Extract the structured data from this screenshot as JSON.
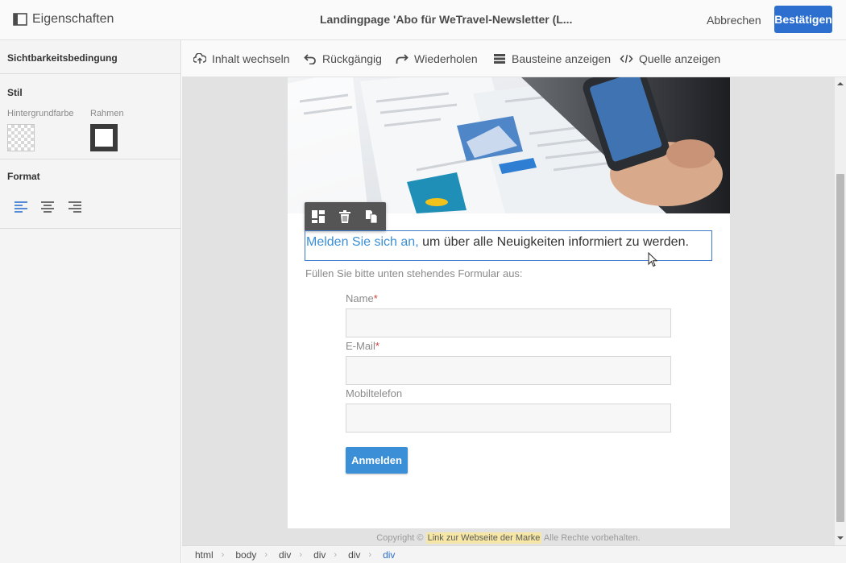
{
  "header": {
    "panel_title": "Eigenschaften",
    "doc_title": "Landingpage 'Abo für WeTravel-Newsletter (L...",
    "cancel_label": "Abbrechen",
    "confirm_label": "Bestätigen"
  },
  "left_panel": {
    "visibility_label": "Sichtbarkeitsbedingung",
    "style": {
      "title": "Stil",
      "background_label": "Hintergrundfarbe",
      "border_label": "Rahmen"
    },
    "format": {
      "title": "Format",
      "alignments": [
        "left",
        "center",
        "right"
      ],
      "active_alignment": "left"
    }
  },
  "toolbar": {
    "items": [
      {
        "label": "Inhalt wechseln",
        "icon": "cloud-upload-icon"
      },
      {
        "label": "Rückgängig",
        "icon": "undo-icon"
      },
      {
        "label": "Wiederholen",
        "icon": "redo-icon"
      },
      {
        "label": "Bausteine anzeigen",
        "icon": "list-icon"
      },
      {
        "label": "Quelle anzeigen",
        "icon": "code-icon"
      }
    ]
  },
  "block_toolbar": {
    "icons": [
      "layout-icon",
      "trash-icon",
      "duplicate-icon"
    ]
  },
  "content": {
    "headline_link": "Melden Sie sich an,",
    "headline_rest": " um über alle Neuigkeiten informiert zu werden.",
    "subtext": "Füllen Sie bitte unten stehendes Formular aus:",
    "fields": [
      {
        "label": "Name",
        "required": true,
        "value": ""
      },
      {
        "label": "E-Mail",
        "required": true,
        "value": ""
      },
      {
        "label": "Mobiltelefon",
        "required": false,
        "value": ""
      }
    ],
    "required_marker": "*",
    "submit_label": "Anmelden"
  },
  "footer": {
    "copyright": "Copyright ©",
    "link_text": "Link zur Webseite der Marke",
    "rights": "Alle Rechte vorbehalten."
  },
  "breadcrumb": [
    "html",
    "body",
    "div",
    "div",
    "div",
    "div"
  ],
  "colors": {
    "accent": "#2d6fce",
    "link_blue": "#3b8fd6",
    "selection_border": "#3b78c9",
    "footer_highlight": "#f6e7a6"
  }
}
